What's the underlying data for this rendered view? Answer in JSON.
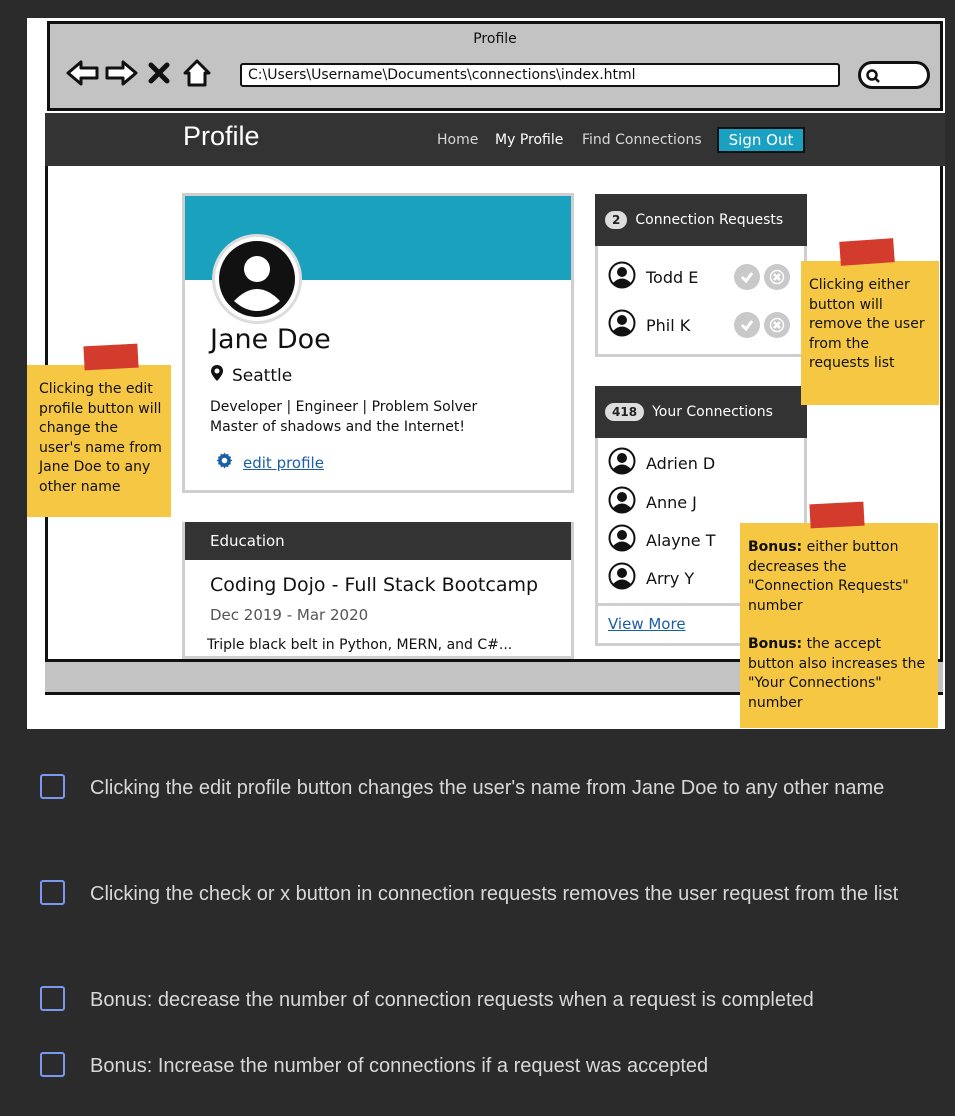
{
  "browser": {
    "window_title": "Profile",
    "address": "C:\\Users\\Username\\Documents\\connections\\index.html",
    "icons": [
      "back-arrow-icon",
      "forward-arrow-icon",
      "close-x-icon",
      "home-icon",
      "search-icon"
    ]
  },
  "site_nav": {
    "brand": "Profile",
    "links": [
      "Home",
      "My Profile",
      "Find Connections"
    ],
    "active_link": "My Profile",
    "sign_out": "Sign Out",
    "accent": "#1aa1c1"
  },
  "profile": {
    "name": "Jane Doe",
    "location": "Seattle",
    "bio_line1": "Developer | Engineer | Problem Solver",
    "bio_line2": "Master of shadows and the Internet!",
    "edit_label": "edit profile",
    "banner_color": "#1aa1bd"
  },
  "education": {
    "header": "Education",
    "title": "Coding Dojo - Full Stack Bootcamp",
    "dates": "Dec 2019 - Mar 2020",
    "description": "Triple black belt in Python, MERN, and C#..."
  },
  "requests": {
    "count": "2",
    "header": "Connection Requests",
    "people": [
      "Todd E",
      "Phil K"
    ]
  },
  "connections": {
    "count": "418",
    "header": "Your Connections",
    "people": [
      "Adrien D",
      "Anne J",
      "Alayne T",
      "Arry Y"
    ],
    "view_more": "View More"
  },
  "notes": {
    "left": "Clicking the edit profile button will change the user's name from Jane Doe to any other name",
    "right": "Clicking either button will remove the user from the requests list",
    "bottom_bold1": "Bonus:",
    "bottom_text1": " either button decreases the \"Connection Requests\" number",
    "bottom_bold2": "Bonus:",
    "bottom_text2": " the accept button also increases the \"Your Connections\" number"
  },
  "tasks": [
    "Clicking the edit profile button changes the user's name from Jane Doe to any other name",
    "Clicking the check or x button in connection requests removes the user request from the list",
    "Bonus: decrease the number of connection requests when a request is completed",
    "Bonus: Increase the number of connections if a request was accepted"
  ]
}
